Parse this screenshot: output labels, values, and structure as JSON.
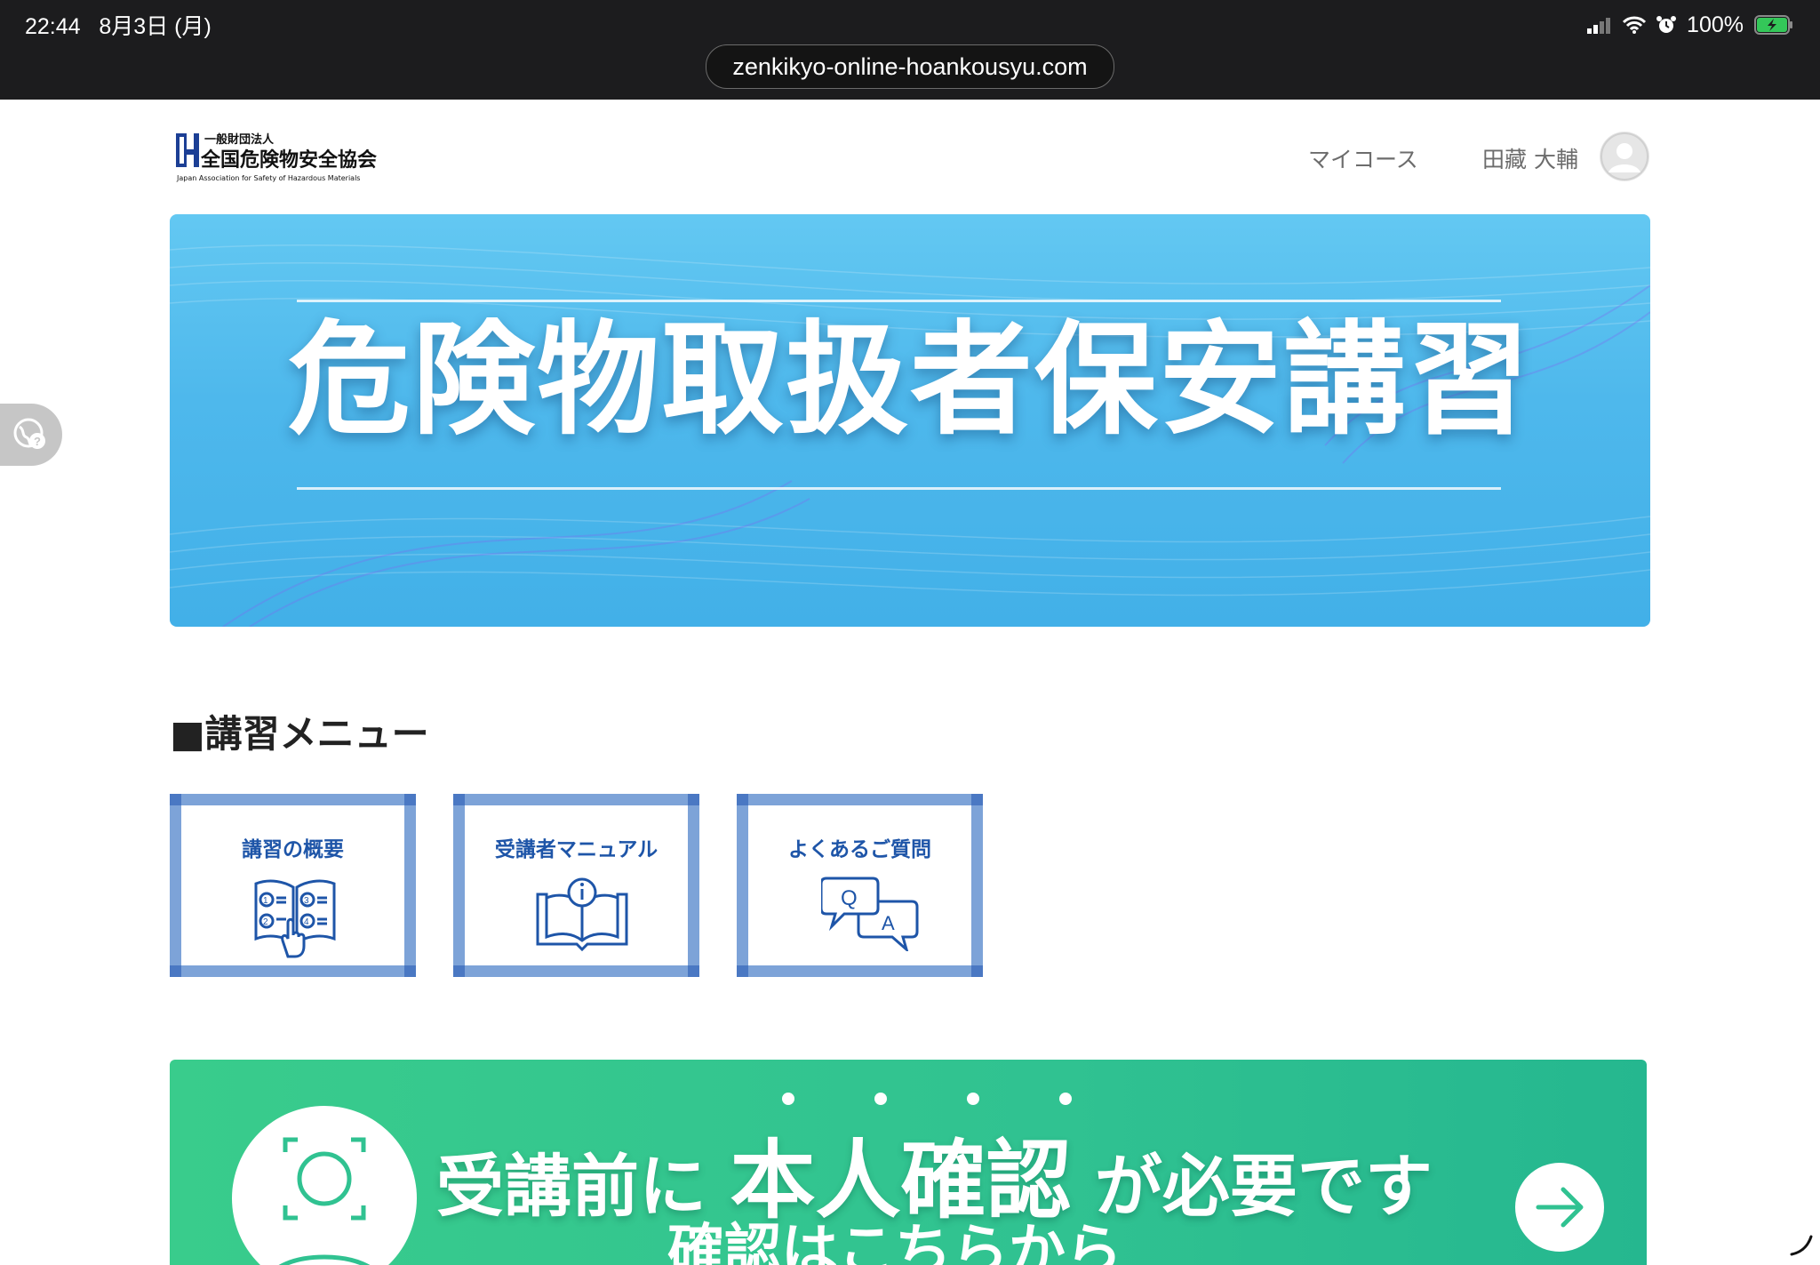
{
  "status_bar": {
    "time": "22:44",
    "date": "8月3日 (月)",
    "battery": "100%",
    "url": "zenkikyo-online-hoankousyu.com"
  },
  "header": {
    "logo_line1": "一般財団法人",
    "logo_line2": "全国危険物安全協会",
    "logo_line3": "Japan Association for Safety of Hazardous Materials",
    "nav_mycourse": "マイコース",
    "user_name": "田藏 大輔"
  },
  "hero": {
    "title": "危険物取扱者保安講習"
  },
  "menu": {
    "heading": "■講習メニュー",
    "cards": [
      {
        "label": "講習の概要",
        "icon": "booklet-pointer-icon"
      },
      {
        "label": "受講者マニュアル",
        "icon": "manual-info-icon"
      },
      {
        "label": "よくあるご質問",
        "icon": "qa-bubbles-icon"
      }
    ]
  },
  "id_banner": {
    "prefix": "受講前に",
    "emphasis": "本人確認",
    "suffix": "が必要です",
    "subtitle": "確認はこちらから"
  },
  "colors": {
    "hero_blue": "#4eb8ec",
    "card_border": "#7da3d8",
    "card_title": "#1e55a8",
    "banner_green": "#30c291"
  }
}
